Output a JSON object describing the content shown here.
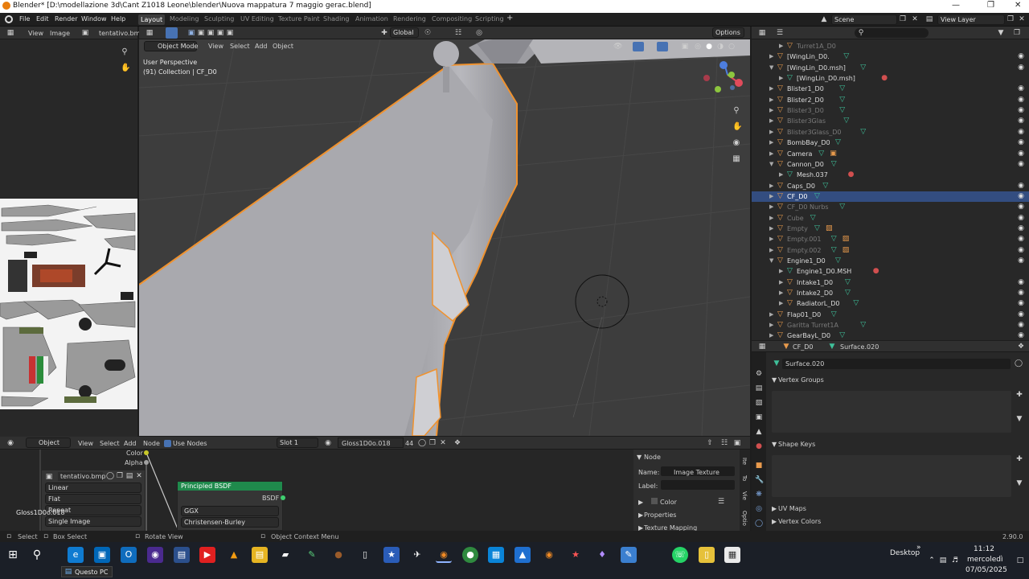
{
  "window": {
    "title": "Blender* [D:\\modellazione 3d\\Cant Z1018 Leone\\blender\\Nuova mappatura  7  maggio gerac.blend]",
    "minimize": "—",
    "maximize": "❐",
    "close": "✕"
  },
  "menu": [
    "File",
    "Edit",
    "Render",
    "Window",
    "Help"
  ],
  "workspaces": [
    "Layout",
    "Modeling",
    "Sculpting",
    "UV Editing",
    "Texture Paint",
    "Shading",
    "Animation",
    "Rendering",
    "Compositing",
    "Scripting",
    "+"
  ],
  "active_workspace": "Layout",
  "scene": {
    "label": "Scene",
    "view_layer": "View Layer"
  },
  "uv_editor": {
    "view": "View",
    "image": "Image",
    "image_name": "tentativo.bmp"
  },
  "viewport": {
    "mode": "Object Mode",
    "menus": [
      "View",
      "Select",
      "Add",
      "Object"
    ],
    "transform": "Global",
    "options": "Options",
    "perspective": "User Perspective",
    "collection_info": "(91) Collection | CF_D0"
  },
  "outliner": {
    "rows": [
      {
        "name": "Turret1A_D0",
        "indent": 3,
        "icon": "tri",
        "dim": true,
        "eye": false
      },
      {
        "name": "[WingLin_D0.",
        "indent": 2,
        "icon": "obj",
        "dim": false,
        "eye": true
      },
      {
        "name": "[WingLin_D0.msh]",
        "indent": 2,
        "icon": "obj",
        "dim": false,
        "eye": true,
        "open": true
      },
      {
        "name": "[WingLin_D0.msh]",
        "indent": 3,
        "icon": "mesh",
        "dim": false,
        "eye": false,
        "extra": "mat"
      },
      {
        "name": "Blister1_D0",
        "indent": 2,
        "icon": "obj",
        "dim": false,
        "eye": true
      },
      {
        "name": "Blister2_D0",
        "indent": 2,
        "icon": "obj",
        "dim": false,
        "eye": true
      },
      {
        "name": "Blister3_D0",
        "indent": 2,
        "icon": "obj",
        "dim": true,
        "eye": true
      },
      {
        "name": "Blister3Glas",
        "indent": 2,
        "icon": "obj",
        "dim": true,
        "eye": true
      },
      {
        "name": "Blister3Glass_D0",
        "indent": 2,
        "icon": "obj",
        "dim": true,
        "eye": true
      },
      {
        "name": "BombBay_D0",
        "indent": 2,
        "icon": "obj",
        "dim": false,
        "eye": true
      },
      {
        "name": "Camera",
        "indent": 2,
        "icon": "obj",
        "dim": false,
        "eye": true,
        "extra": "cam"
      },
      {
        "name": "Cannon_D0",
        "indent": 2,
        "icon": "obj",
        "dim": false,
        "eye": true,
        "open": true
      },
      {
        "name": "Mesh.037",
        "indent": 3,
        "icon": "mesh",
        "dim": false,
        "eye": false,
        "extra": "mat"
      },
      {
        "name": "Caps_D0",
        "indent": 2,
        "icon": "obj",
        "dim": false,
        "eye": true
      },
      {
        "name": "CF_D0",
        "indent": 2,
        "icon": "obj",
        "dim": false,
        "eye": true,
        "selected": true
      },
      {
        "name": "CF_D0 Nurbs",
        "indent": 2,
        "icon": "obj",
        "dim": true,
        "eye": true
      },
      {
        "name": "Cube",
        "indent": 2,
        "icon": "obj",
        "dim": true,
        "eye": true
      },
      {
        "name": "Empty",
        "indent": 2,
        "icon": "obj",
        "dim": true,
        "eye": true,
        "extra": "img"
      },
      {
        "name": "Empty.001",
        "indent": 2,
        "icon": "obj",
        "dim": true,
        "eye": true,
        "extra": "img"
      },
      {
        "name": "Empty.002",
        "indent": 2,
        "icon": "obj",
        "dim": true,
        "eye": true,
        "extra": "img"
      },
      {
        "name": "Engine1_D0",
        "indent": 2,
        "icon": "obj",
        "dim": false,
        "eye": true,
        "open": true
      },
      {
        "name": "Engine1_D0.MSH",
        "indent": 3,
        "icon": "mesh",
        "dim": false,
        "eye": false,
        "extra": "mat"
      },
      {
        "name": "Intake1_D0",
        "indent": 3,
        "icon": "obj",
        "dim": false,
        "eye": true
      },
      {
        "name": "Intake2_D0",
        "indent": 3,
        "icon": "obj",
        "dim": false,
        "eye": true
      },
      {
        "name": "RadiatorL_D0",
        "indent": 3,
        "icon": "obj",
        "dim": false,
        "eye": true
      },
      {
        "name": "Flap01_D0",
        "indent": 2,
        "icon": "obj",
        "dim": false,
        "eye": true
      },
      {
        "name": "Garitta Turret1A",
        "indent": 2,
        "icon": "obj",
        "dim": true,
        "eye": true
      },
      {
        "name": "GearBayL_D0",
        "indent": 2,
        "icon": "obj",
        "dim": false,
        "eye": true
      }
    ]
  },
  "properties": {
    "object": "CF_D0",
    "mesh": "Surface.020",
    "data_name": "Surface.020",
    "panels": [
      "Vertex Groups",
      "Shape Keys",
      "UV Maps",
      "Vertex Colors"
    ]
  },
  "node_editor": {
    "object": "Object",
    "menus": [
      "View",
      "Select",
      "Add",
      "Node"
    ],
    "use_nodes": "Use Nodes",
    "slot": "Slot 1",
    "material": "Gloss1D0o.018",
    "users": "44",
    "material_label": "Gloss1D0o.018",
    "socket_color": "Color",
    "socket_alpha": "Alpha",
    "image_node": {
      "image": "tentativo.bmp",
      "interpolation": "Linear",
      "projection": "Flat",
      "extension": "Repeat",
      "source": "Single Image"
    },
    "bsdf_node": {
      "title": "Principled BSDF",
      "output": "BSDF",
      "distribution": "GGX",
      "subsurface": "Christensen-Burley"
    },
    "sidebar": {
      "header": "Node",
      "name_label": "Name:",
      "name_value": "Image Texture",
      "label_label": "Label:",
      "color": "Color",
      "properties": "Properties",
      "texture_mapping": "Texture Mapping",
      "tabs": [
        "Ite",
        "To",
        "Vie",
        "Optio"
      ]
    }
  },
  "statusbar": {
    "select": "Select",
    "box_select": "Box Select",
    "rotate": "Rotate View",
    "context": "Object Context Menu",
    "version": "2.90.0"
  },
  "taskbar": {
    "desktop": "Desktop",
    "time": "11:12",
    "day": "mercoledì",
    "date": "07/05/2025",
    "tooltip": "Questo PC"
  },
  "colors": {
    "accent": "#334d80",
    "selection_outline": "#f0922e",
    "node_header_green": "#1f8a4c"
  }
}
